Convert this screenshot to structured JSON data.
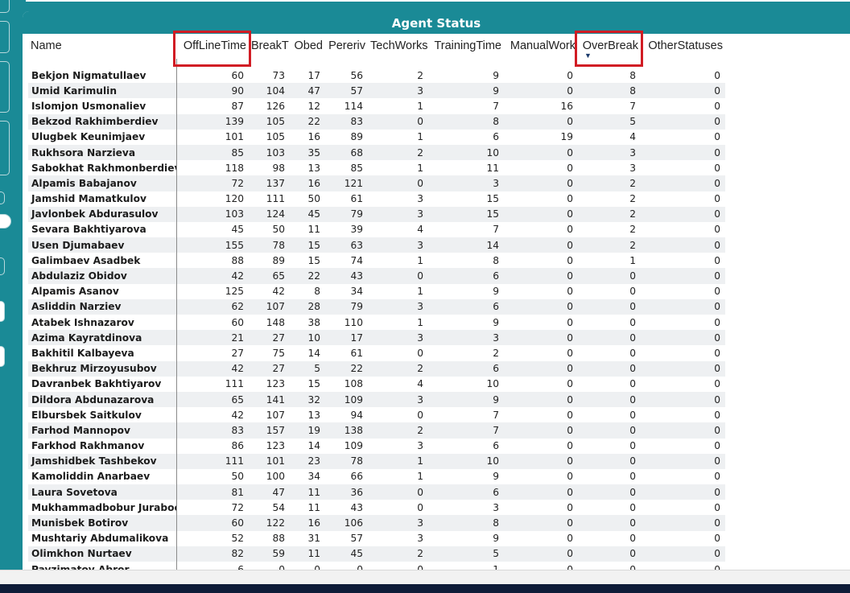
{
  "panel": {
    "title": "Agent Status"
  },
  "columns": [
    "Name",
    "OffLineTime",
    "BreakT",
    "Obed",
    "Pereriv",
    "TechWorks",
    "TrainingTime",
    "ManualWork",
    "OverBreak",
    "OtherStatuses"
  ],
  "sort": {
    "column": "OverBreak",
    "direction": "descending",
    "icon": "sort-descending-icon"
  },
  "highlighted_columns": [
    "OffLineTime",
    "OverBreak"
  ],
  "highlight_color": "#d11c24",
  "accent_color": "#1a8a96",
  "rows": [
    [
      "Bekjon Nigmatullaev",
      "60",
      "73",
      "17",
      "56",
      "2",
      "9",
      "0",
      "8",
      "0"
    ],
    [
      "Umid Karimulin",
      "90",
      "104",
      "47",
      "57",
      "3",
      "9",
      "0",
      "8",
      "0"
    ],
    [
      "Islomjon Usmonaliev",
      "87",
      "126",
      "12",
      "114",
      "1",
      "7",
      "16",
      "7",
      "0"
    ],
    [
      "Bekzod Rakhimberdiev",
      "139",
      "105",
      "22",
      "83",
      "0",
      "8",
      "0",
      "5",
      "0"
    ],
    [
      "Ulugbek Keunimjaev",
      "101",
      "105",
      "16",
      "89",
      "1",
      "6",
      "19",
      "4",
      "0"
    ],
    [
      "Rukhsora Narzieva",
      "85",
      "103",
      "35",
      "68",
      "2",
      "10",
      "0",
      "3",
      "0"
    ],
    [
      "Sabokhat Rakhmonberdieva",
      "118",
      "98",
      "13",
      "85",
      "1",
      "11",
      "0",
      "3",
      "0"
    ],
    [
      "Alpamis Babajanov",
      "72",
      "137",
      "16",
      "121",
      "0",
      "3",
      "0",
      "2",
      "0"
    ],
    [
      "Jamshid Mamatkulov",
      "120",
      "111",
      "50",
      "61",
      "3",
      "15",
      "0",
      "2",
      "0"
    ],
    [
      "Javlonbek Abdurasulov",
      "103",
      "124",
      "45",
      "79",
      "3",
      "15",
      "0",
      "2",
      "0"
    ],
    [
      "Sevara Bakhtiyarova",
      "45",
      "50",
      "11",
      "39",
      "4",
      "7",
      "0",
      "2",
      "0"
    ],
    [
      "Usen Djumabaev",
      "155",
      "78",
      "15",
      "63",
      "3",
      "14",
      "0",
      "2",
      "0"
    ],
    [
      "Galimbaev Asadbek",
      "88",
      "89",
      "15",
      "74",
      "1",
      "8",
      "0",
      "1",
      "0"
    ],
    [
      "Abdulaziz Obidov",
      "42",
      "65",
      "22",
      "43",
      "0",
      "6",
      "0",
      "0",
      "0"
    ],
    [
      "Alpamis Asanov",
      "125",
      "42",
      "8",
      "34",
      "1",
      "9",
      "0",
      "0",
      "0"
    ],
    [
      "Asliddin Narziev",
      "62",
      "107",
      "28",
      "79",
      "3",
      "6",
      "0",
      "0",
      "0"
    ],
    [
      "Atabek Ishnazarov",
      "60",
      "148",
      "38",
      "110",
      "1",
      "9",
      "0",
      "0",
      "0"
    ],
    [
      "Azima Kayratdinova",
      "21",
      "27",
      "10",
      "17",
      "3",
      "3",
      "0",
      "0",
      "0"
    ],
    [
      "Bakhitil Kalbayeva",
      "27",
      "75",
      "14",
      "61",
      "0",
      "2",
      "0",
      "0",
      "0"
    ],
    [
      "Bekhruz Mirzoyusubov",
      "42",
      "27",
      "5",
      "22",
      "2",
      "6",
      "0",
      "0",
      "0"
    ],
    [
      "Davranbek Bakhtiyarov",
      "111",
      "123",
      "15",
      "108",
      "4",
      "10",
      "0",
      "0",
      "0"
    ],
    [
      "Dildora Abdunazarova",
      "65",
      "141",
      "32",
      "109",
      "3",
      "9",
      "0",
      "0",
      "0"
    ],
    [
      "Elbursbek Saitkulov",
      "42",
      "107",
      "13",
      "94",
      "0",
      "7",
      "0",
      "0",
      "0"
    ],
    [
      "Farhod Mannopov",
      "83",
      "157",
      "19",
      "138",
      "2",
      "7",
      "0",
      "0",
      "0"
    ],
    [
      "Farkhod Rakhmanov",
      "86",
      "123",
      "14",
      "109",
      "3",
      "6",
      "0",
      "0",
      "0"
    ],
    [
      "Jamshidbek Tashbekov",
      "111",
      "101",
      "23",
      "78",
      "1",
      "10",
      "0",
      "0",
      "0"
    ],
    [
      "Kamoliddin Anarbaev",
      "50",
      "100",
      "34",
      "66",
      "1",
      "9",
      "0",
      "0",
      "0"
    ],
    [
      "Laura Sovetova",
      "81",
      "47",
      "11",
      "36",
      "0",
      "6",
      "0",
      "0",
      "0"
    ],
    [
      "Mukhammadbobur Juraboev",
      "72",
      "54",
      "11",
      "43",
      "0",
      "3",
      "0",
      "0",
      "0"
    ],
    [
      "Munisbek Botirov",
      "60",
      "122",
      "16",
      "106",
      "3",
      "8",
      "0",
      "0",
      "0"
    ],
    [
      "Mushtariy Abdumalikova",
      "52",
      "88",
      "31",
      "57",
      "3",
      "9",
      "0",
      "0",
      "0"
    ],
    [
      "Olimkhon Nurtaev",
      "82",
      "59",
      "11",
      "45",
      "2",
      "5",
      "0",
      "0",
      "0"
    ],
    [
      "Payzimatov Abror",
      "6",
      "0",
      "0",
      "0",
      "0",
      "1",
      "0",
      "0",
      "0"
    ]
  ]
}
